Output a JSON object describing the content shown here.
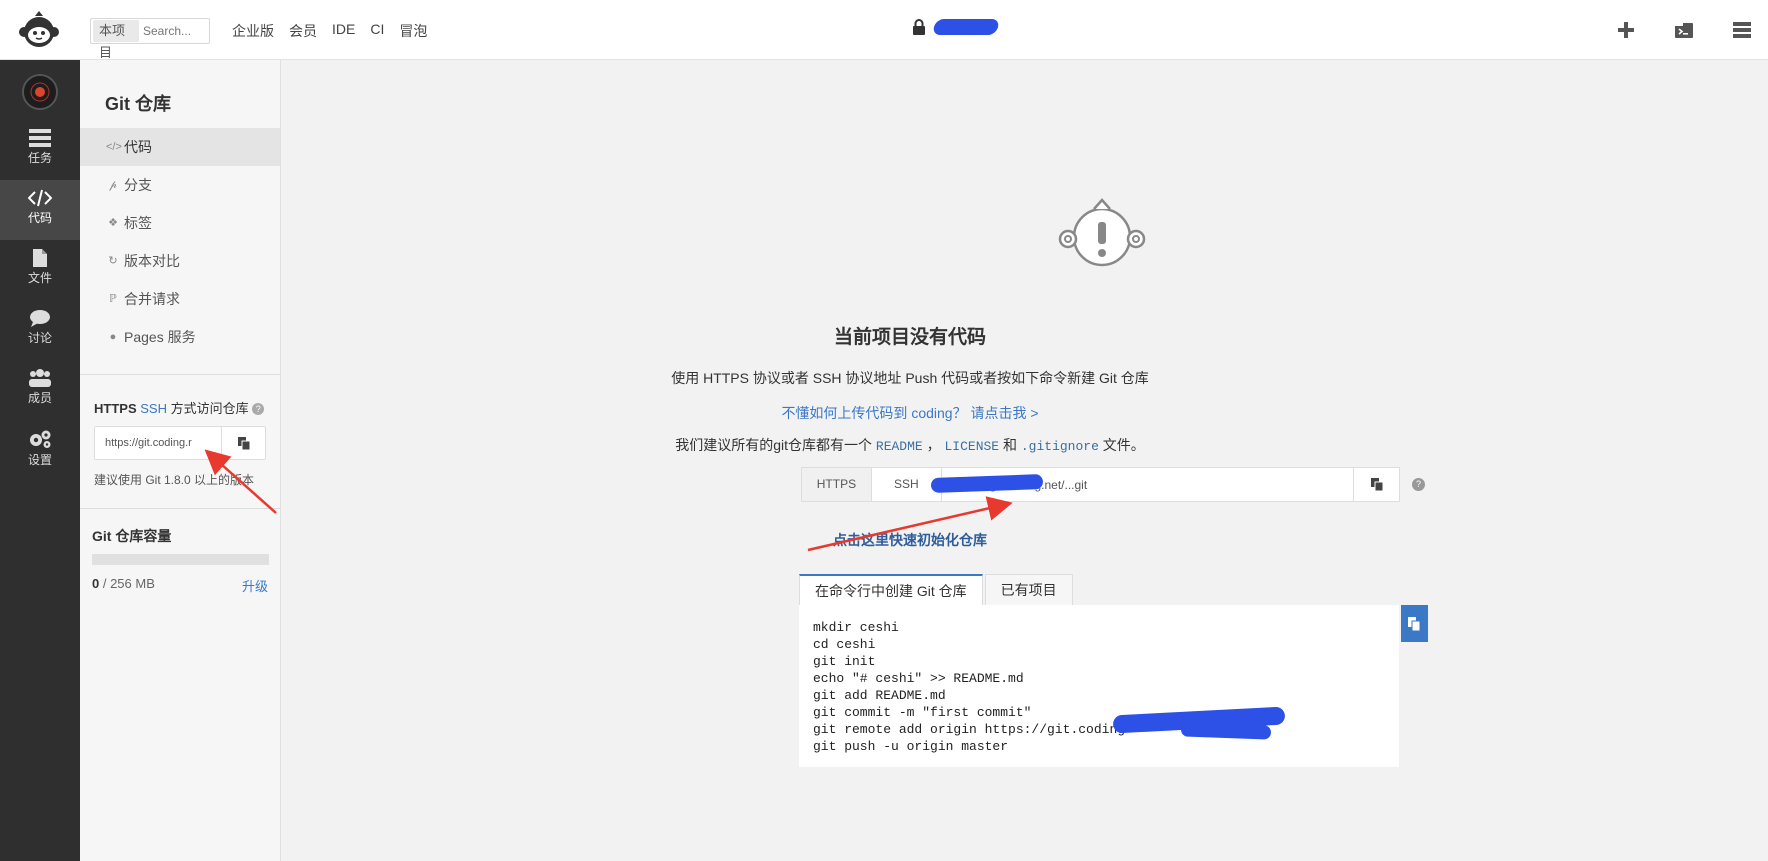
{
  "topbar": {
    "search_scope": "本项目",
    "search_placeholder": "Search...",
    "nav": [
      "企业版",
      "会员",
      "IDE",
      "CI",
      "冒泡"
    ]
  },
  "rail": {
    "items": [
      {
        "label": "任务",
        "icon": "tasks-icon"
      },
      {
        "label": "代码",
        "icon": "code-icon"
      },
      {
        "label": "文件",
        "icon": "file-icon"
      },
      {
        "label": "讨论",
        "icon": "discussion-icon"
      },
      {
        "label": "成员",
        "icon": "members-icon"
      },
      {
        "label": "设置",
        "icon": "settings-icon"
      }
    ]
  },
  "sidebar": {
    "title": "Git 仓库",
    "menu": [
      {
        "label": "代码",
        "icon": "code-icon"
      },
      {
        "label": "分支",
        "icon": "branch-icon"
      },
      {
        "label": "标签",
        "icon": "tag-icon"
      },
      {
        "label": "版本对比",
        "icon": "compare-icon"
      },
      {
        "label": "合并请求",
        "icon": "merge-request-icon"
      },
      {
        "label": "Pages 服务",
        "icon": "globe-icon"
      }
    ],
    "access_https": "HTTPS",
    "access_ssh": "SSH",
    "access_suffix": "方式访问仓库",
    "url_value": "https://git.coding.r",
    "git_hint": "建议使用 Git 1.8.0 以上的版本",
    "capacity_title": "Git 仓库容量",
    "capacity_used": "0",
    "capacity_total": " / 256 MB",
    "capacity_used_fraction": 0,
    "upgrade": "升级"
  },
  "main": {
    "empty_title": "当前项目没有代码",
    "desc1": "使用 HTTPS 协议或者 SSH 协议地址 Push 代码或者按如下命令新建 Git 仓库",
    "help_link": "不懂如何上传代码到 coding？ 请点击我 >",
    "desc2_prefix": "我们建议所有的git仓库都有一个 ",
    "readme": "README",
    "comma": " ， ",
    "license": "LICENSE",
    "and": " 和 ",
    "gitignore": ".gitignore",
    "desc2_suffix": " 文件。",
    "proto_https": "HTTPS",
    "proto_ssh": "SSH",
    "clone_url": "https://git.coding.net/...git",
    "init_link": "点击这里快速初始化仓库",
    "tabs": [
      "在命令行中创建 Git 仓库",
      "已有项目"
    ],
    "commands": [
      "mkdir ceshi",
      "cd ceshi",
      "git init",
      "echo \"# ceshi\" >> README.md",
      "git add README.md",
      "git commit -m \"first commit\"",
      "git remote add origin https://git.coding",
      "git push -u origin master"
    ]
  },
  "colors": {
    "accent": "#3b78c6",
    "rail_bg": "#2f2f2f",
    "annotation_arrow": "#e8392f",
    "redaction": "#2d50e6"
  }
}
